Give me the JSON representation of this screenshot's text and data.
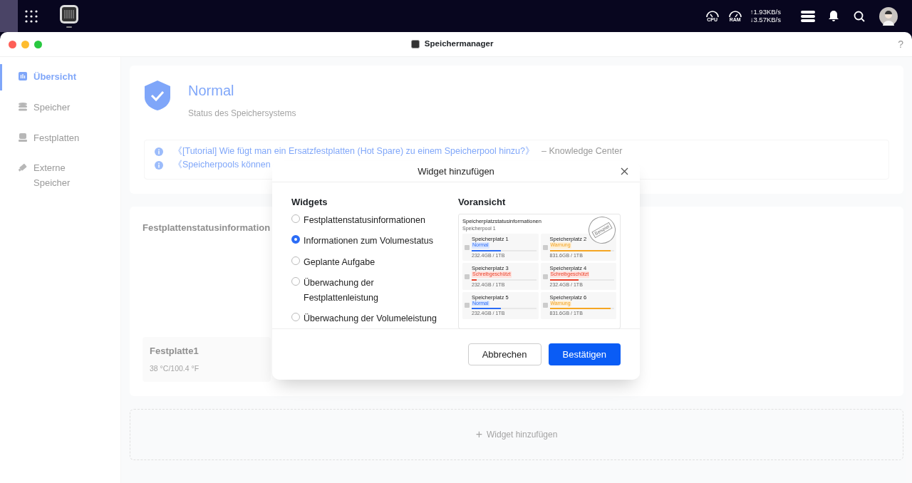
{
  "topbar": {
    "net_up": "↑1.93KB/s",
    "net_down": "↓3.57KB/s",
    "cpu_label": "CPU",
    "ram_label": "RAM"
  },
  "window": {
    "title": "Speichermanager",
    "help": "?"
  },
  "sidebar": {
    "items": [
      {
        "label": "Übersicht",
        "selected": true,
        "kind": "overview"
      },
      {
        "label": "Speicher",
        "selected": false,
        "kind": "storage"
      },
      {
        "label": "Festplatten",
        "selected": false,
        "kind": "disk"
      },
      {
        "label": "Externe Speicher",
        "selected": false,
        "kind": "external"
      }
    ]
  },
  "status": {
    "title": "Normal",
    "subtitle": "Status des Speichersystems"
  },
  "tips": [
    {
      "link": "《[Tutorial] Wie fügt man ein Ersatzfestplatten (Hot Spare) zu einem Speicherpool hinzu?》",
      "source": "– Knowledge Center"
    },
    {
      "link": "《Speicherpools können"
    }
  ],
  "disk_widget": {
    "title": "Festplattenstatusinformation",
    "disk_name": "Festplatte1",
    "disk_temp": "38 °C/100.4 °F"
  },
  "add_widget": {
    "icon": "+",
    "label": "Widget hinzufügen"
  },
  "dialog": {
    "title": "Widget hinzufügen",
    "widgets_heading": "Widgets",
    "preview_heading": "Voransicht",
    "options": [
      {
        "label": "Festplattenstatusinformationen",
        "selected": false
      },
      {
        "label": "Informationen zum Volumestatus",
        "selected": true
      },
      {
        "label": "Geplante Aufgabe",
        "selected": false
      },
      {
        "label": "Überwachung der Festplattenleistung",
        "selected": false
      },
      {
        "label": "Überwachung der Volumeleistung",
        "selected": false
      }
    ],
    "preview": {
      "title": "Speicherplatzstatusinformationen",
      "pool": "Speicherpool 1",
      "stamp": "Beispiel",
      "slots": [
        {
          "name": "Speicherplatz 1",
          "badge": "Normal",
          "kind": "normal",
          "level": 0.45,
          "size": "232.4GB / 1TB"
        },
        {
          "name": "Speicherplatz 2",
          "badge": "Warnung",
          "kind": "warning",
          "level": 0.95,
          "size": "831.6GB / 1TB"
        },
        {
          "name": "Speicherplatz 3",
          "badge": "Schreibgeschützt",
          "kind": "readonly",
          "level": 0.08,
          "size": "232.4GB / 1TB"
        },
        {
          "name": "Speicherplatz 4",
          "badge": "Schreibgeschützt",
          "kind": "readonly",
          "level": 0.45,
          "size": "232.4GB / 1TB"
        },
        {
          "name": "Speicherplatz 5",
          "badge": "Normal",
          "kind": "normal",
          "level": 0.45,
          "size": "232.4GB / 1TB"
        },
        {
          "name": "Speicherplatz 6",
          "badge": "Warnung",
          "kind": "warning",
          "level": 0.95,
          "size": "831.6GB / 1TB"
        }
      ]
    },
    "cancel": "Abbrechen",
    "confirm": "Bestätigen"
  }
}
